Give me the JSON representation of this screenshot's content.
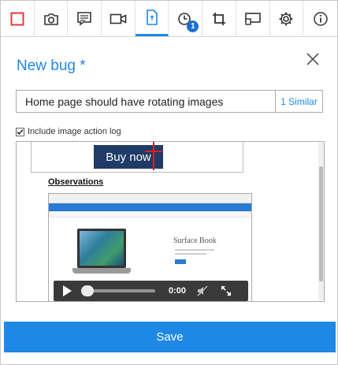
{
  "toolbar": {
    "items": [
      {
        "icon": "stop-recording-icon",
        "color": "#e53935"
      },
      {
        "icon": "camera-icon"
      },
      {
        "icon": "note-icon"
      },
      {
        "icon": "video-icon"
      },
      {
        "icon": "document-icon",
        "active": true
      },
      {
        "icon": "history-icon",
        "badge": "1"
      },
      {
        "icon": "crop-icon"
      },
      {
        "icon": "screen-icon"
      },
      {
        "icon": "gear-icon"
      },
      {
        "icon": "info-icon"
      }
    ]
  },
  "header": {
    "title": "New bug *"
  },
  "bug": {
    "title_value": "Home page should have rotating images",
    "similar_label": "1 Similar"
  },
  "options": {
    "include_action_log_label": "Include image action log"
  },
  "description": {
    "buy_now_label": "Buy now",
    "observations_label": "Observations",
    "video": {
      "product_text": "Surface Book",
      "time": "0:00"
    }
  },
  "footer": {
    "save_label": "Save"
  },
  "colors": {
    "accent": "#1e88e5",
    "stop": "#e53935",
    "badge": "#1e6fd0"
  }
}
